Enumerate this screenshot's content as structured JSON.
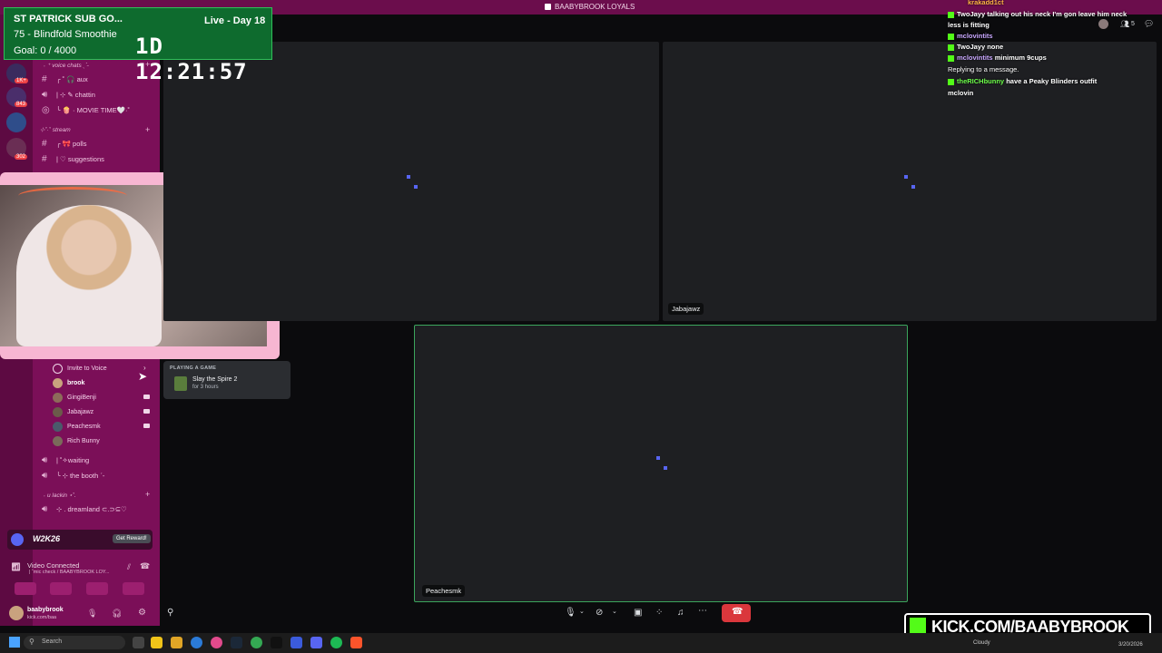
{
  "window": {
    "title": "BAABYBROOK LOYALS"
  },
  "subgoal": {
    "title": "ST PATRICK SUB GO...",
    "live": "Live - Day 18",
    "item": "75 - Blindfold Smoothie",
    "goal": "Goal: 0 / 4000",
    "timer": "1D 12:21:57"
  },
  "rail": {
    "badges": [
      "1K+",
      "843",
      "302"
    ]
  },
  "sidebar": {
    "category_voice": "˖ ⁺ voice chats ˎˊ˗",
    "channels_top": [
      {
        "label": "╭ ˚ 🎧 aux",
        "type": "text"
      },
      {
        "label": "| ⊹ ✎ chattin",
        "type": "voice"
      },
      {
        "label": "╰ 🍿 · MOVIE TIME🤍·˚",
        "type": "voice"
      }
    ],
    "category_stream": "⊹˚·˚ stream",
    "channels_stream": [
      {
        "label": "╭ 🎀 polls",
        "type": "text"
      },
      {
        "label": "| ♡ suggestions",
        "type": "text"
      }
    ],
    "invite": "Invite to Voice",
    "members": [
      "brook",
      "GingiBenji",
      "Jabajawz",
      "Peachesmk",
      "Rich Bunny"
    ],
    "channels_bottom": [
      {
        "label": "| ˚✧waiting",
        "type": "voice"
      },
      {
        "label": "╰ ⊹ the booth ˊ-",
        "type": "voice"
      }
    ],
    "category_lackin": "˖ u lackin ⋆˚.",
    "channel_dream": "⊹ . dreamland ⊂.⊃⊆♡"
  },
  "playing": {
    "label": "PLAYING A GAME",
    "game": "Slay the Spire 2",
    "duration": "for 3 hours"
  },
  "promo": {
    "title": "W2K26",
    "button": "Get Reward!"
  },
  "voice": {
    "status": "Video Connected",
    "channel": "| ˚mic check / BAABYBROOK LOY..."
  },
  "user": {
    "name": "baabybrook",
    "sub": "kick.com/baa"
  },
  "tiles": {
    "top_right_name": "Jabajawz",
    "bottom_name": "Peachesmk"
  },
  "chat": [
    {
      "user": "krakadd1ct",
      "text": "",
      "color": "orange"
    },
    {
      "user": "TwoJayy",
      "text": "talking out his neck I'm gon leave him neck",
      "color": "white"
    },
    {
      "user": "",
      "text": "less is fitting",
      "color": "white"
    },
    {
      "user": "mclovintits",
      "text": "",
      "color": "purple"
    },
    {
      "user": "TwoJayy",
      "text": "none",
      "color": "white"
    },
    {
      "user": "mclovintits",
      "text": "minimum 9cups",
      "color": "purple"
    },
    {
      "user": "",
      "text": "Replying to a message.",
      "color": "white"
    },
    {
      "user": "theRICHbunny",
      "text": "have a Peaky Blinders outfit",
      "color": "green"
    },
    {
      "user": "",
      "text": "mclovin",
      "color": "white"
    }
  ],
  "viewers": "5",
  "kick_banner": "KICK.COM/BAABYBROOK",
  "taskbar": {
    "search": "Search",
    "weather": "Cloudy",
    "date": "3/20/2026"
  }
}
